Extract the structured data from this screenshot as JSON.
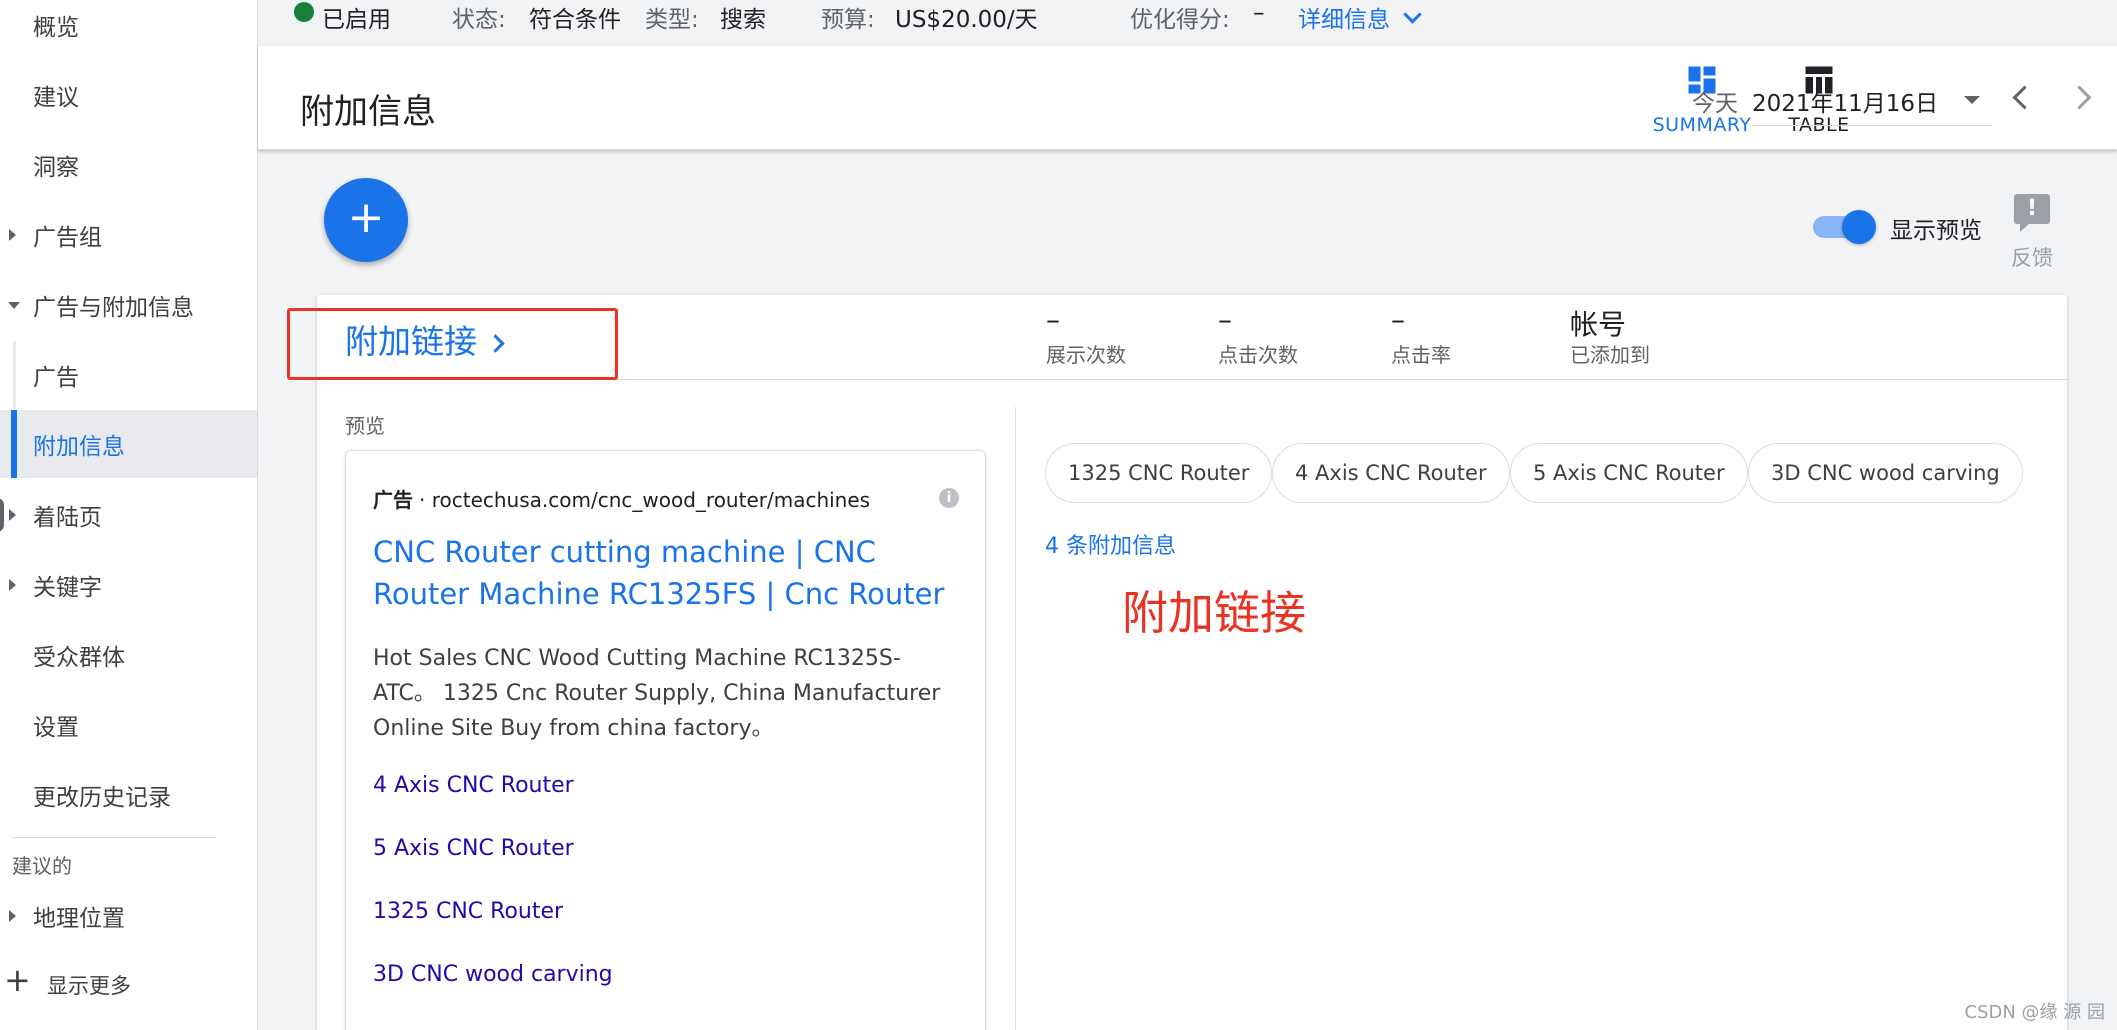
{
  "sidebar": {
    "items": [
      {
        "label": "概览"
      },
      {
        "label": "建议"
      },
      {
        "label": "洞察"
      },
      {
        "label": "广告组"
      },
      {
        "label": "广告与附加信息"
      },
      {
        "label": "广告"
      },
      {
        "label": "附加信息"
      },
      {
        "label": "着陆页"
      },
      {
        "label": "关键字"
      },
      {
        "label": "受众群体"
      },
      {
        "label": "设置"
      },
      {
        "label": "更改历史记录"
      }
    ],
    "section_label": "建议的",
    "geo_label": "地理位置",
    "show_more": "显示更多"
  },
  "status_bar": {
    "enabled": "已启用",
    "status_key": "状态:",
    "status_val": "符合条件",
    "type_key": "类型:",
    "type_val": "搜索",
    "budget_key": "预算:",
    "budget_val": "US$20.00/天",
    "score_key": "优化得分:",
    "score_val": "–",
    "details": "详细信息"
  },
  "header": {
    "title": "附加信息",
    "summary": "SUMMARY",
    "table": "TABLE",
    "today": "今天",
    "date": "2021年11月16日"
  },
  "toolbar": {
    "show_preview": "显示预览",
    "feedback": "反馈"
  },
  "card": {
    "title": "附加链接",
    "metrics": [
      {
        "value": "–",
        "label": "展示次数"
      },
      {
        "value": "–",
        "label": "点击次数"
      },
      {
        "value": "–",
        "label": "点击率"
      },
      {
        "value": "帐号",
        "label": "已添加到"
      }
    ],
    "preview_label": "预览",
    "ad": {
      "badge": "广告",
      "url": "· roctechusa.com/cnc_wood_router/machines",
      "headline": "CNC Router cutting machine | CNC Router Machine RC1325FS | Cnc Router",
      "description": "Hot Sales CNC Wood Cutting Machine RC1325S-ATC。 1325 Cnc Router Supply, China Manufacturer Online Site Buy from china factory。",
      "links": [
        "4 Axis CNC Router",
        "5 Axis CNC Router",
        "1325 CNC Router",
        "3D CNC wood carving"
      ]
    },
    "chips": [
      "1325 CNC Router",
      "4 Axis CNC Router",
      "5 Axis CNC Router",
      "3D CNC wood carving"
    ],
    "ext_count": "4 条附加信息",
    "annotation": "附加链接"
  },
  "watermark": "CSDN @缘 源 园",
  "colors": {
    "accent": "#1a73e8",
    "enabled": "#188038",
    "annotation_red": "#ea3323"
  }
}
